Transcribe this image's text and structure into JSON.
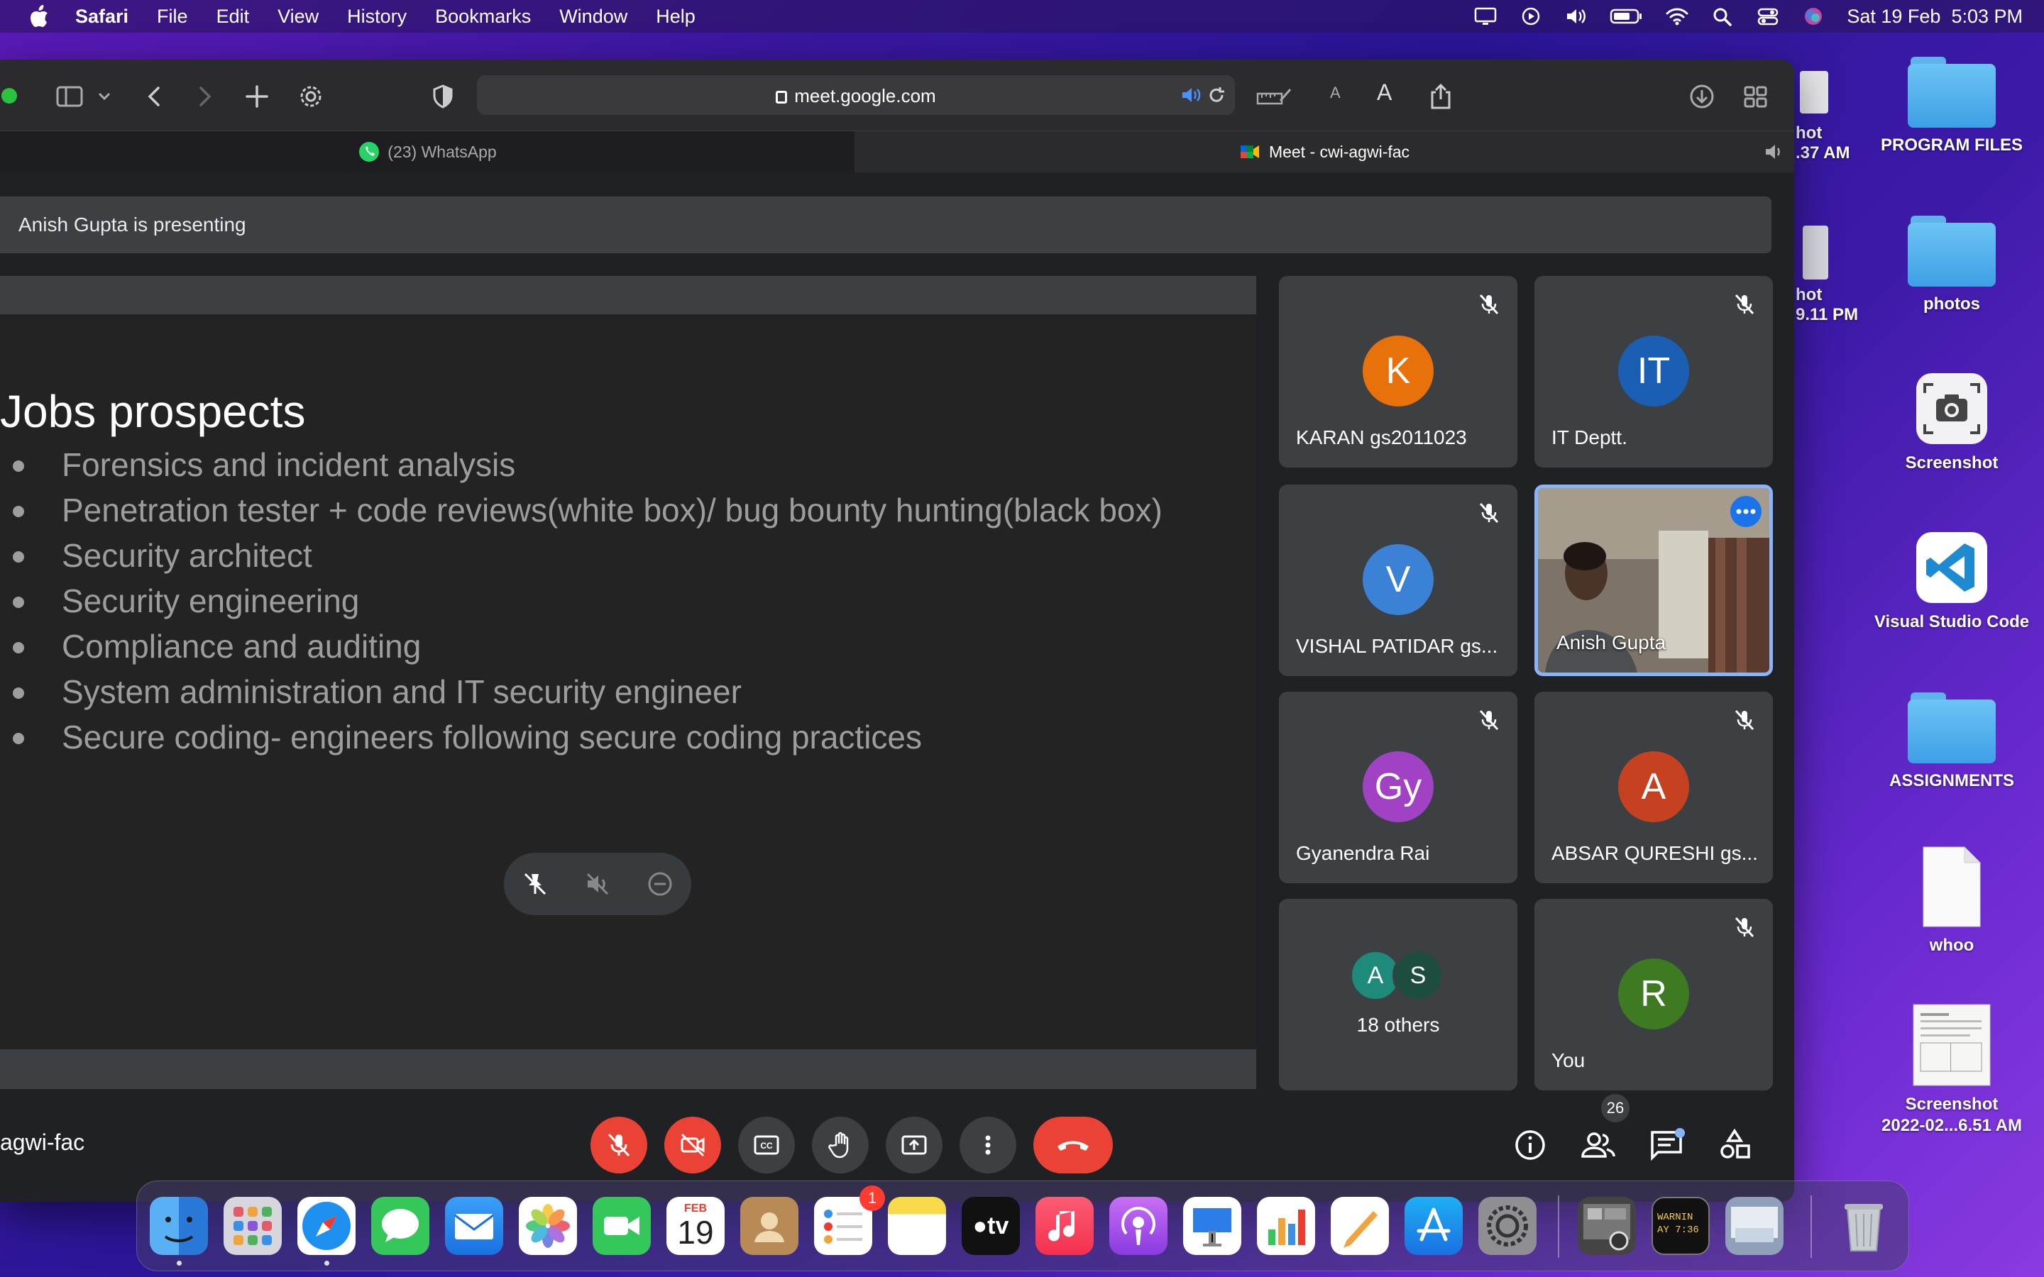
{
  "menubar": {
    "app_name": "Safari",
    "menus": [
      "File",
      "Edit",
      "View",
      "History",
      "Bookmarks",
      "Window",
      "Help"
    ],
    "datetime": "Sat 19 Feb  5:03 PM"
  },
  "desktop": {
    "partial_items": [
      {
        "line1": "hot",
        "line2": ".37 AM"
      },
      {
        "line1": "hot",
        "line2": "9.11 PM"
      }
    ],
    "items": [
      {
        "label": "PROGRAM FILES",
        "kind": "folder"
      },
      {
        "label": "photos",
        "kind": "folder"
      },
      {
        "label": "Screenshot",
        "kind": "app"
      },
      {
        "label": "Visual Studio Code",
        "kind": "app"
      },
      {
        "label": "ASSIGNMENTS",
        "kind": "folder"
      },
      {
        "label": "whoo",
        "kind": "file"
      },
      {
        "label": "Screenshot\n2022-02...6.51 AM",
        "kind": "image"
      }
    ]
  },
  "browser": {
    "url": "meet.google.com",
    "tabs": [
      {
        "label": "(23) WhatsApp",
        "active": false
      },
      {
        "label": "Meet - cwi-agwi-fac",
        "active": true
      }
    ]
  },
  "meet": {
    "presenting_text": "Anish Gupta is presenting",
    "slide": {
      "title": "Jobs prospects",
      "bullets": [
        "Forensics and incident analysis",
        "Penetration tester + code reviews(white box)/ bug bounty hunting(black box)",
        "Security architect",
        "Security engineering",
        "Compliance and auditing",
        "System administration and IT security engineer",
        "Secure coding- engineers following secure coding practices"
      ]
    },
    "participants": [
      {
        "name": "KARAN gs2011023",
        "initials": "K",
        "color": "#e8710a",
        "muted": true
      },
      {
        "name": "IT Deptt.",
        "initials": "IT",
        "color": "#1a5fb4",
        "muted": true
      },
      {
        "name": "VISHAL PATIDAR gs...",
        "initials": "V",
        "color": "#3b82d6",
        "muted": true
      },
      {
        "name": "Anish Gupta",
        "initials": "",
        "video": true
      },
      {
        "name": "Gyanendra Rai",
        "initials": "Gy",
        "color": "#a142c4",
        "muted": true
      },
      {
        "name": "ABSAR QURESHI gs...",
        "initials": "A",
        "color": "#c5411f",
        "muted": true
      },
      {
        "name": "You",
        "initials": "R",
        "color": "#3d7a22",
        "muted": true
      }
    ],
    "others": {
      "avatar1": "A",
      "avatar2": "S",
      "label": "18 others"
    },
    "meeting_code": "agwi-fac",
    "people_count": "26"
  },
  "dock": {
    "calendar_month": "FEB",
    "calendar_day": "19",
    "reminders_badge": "1",
    "tv_label": "tv",
    "console_text": "WARNIN\nAY 7:36"
  }
}
